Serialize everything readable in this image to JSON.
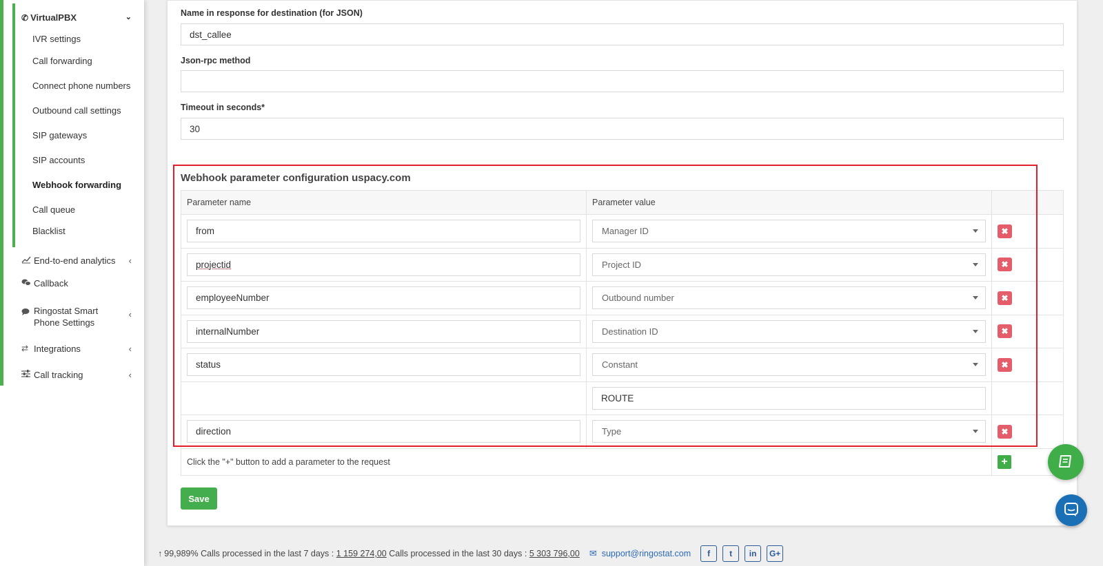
{
  "sidebar": {
    "section_title": "VirtualPBX",
    "sub_items": [
      {
        "label": "IVR settings"
      },
      {
        "label": "Call forwarding"
      },
      {
        "label": "Connect phone numbers"
      },
      {
        "label": "Outbound call settings"
      },
      {
        "label": "SIP gateways"
      },
      {
        "label": "SIP accounts"
      },
      {
        "label": "Webhook forwarding",
        "active": true
      },
      {
        "label": "Call queue"
      },
      {
        "label": "Blacklist"
      }
    ],
    "main_items": [
      {
        "label": "End-to-end analytics",
        "icon": "chart-line-icon"
      },
      {
        "label": "Callback",
        "icon": "chat-icon"
      },
      {
        "label": "Ringostat Smart Phone Settings",
        "icon": "comments-icon"
      },
      {
        "label": "Integrations",
        "icon": "exchange-icon"
      },
      {
        "label": "Call tracking",
        "icon": "sliders-icon"
      }
    ]
  },
  "form": {
    "name_response_label": "Name in response for destination (for JSON)",
    "name_response_value": "dst_callee",
    "jsonrpc_label": "Json-rpc method",
    "jsonrpc_value": "",
    "timeout_label": "Timeout in seconds*",
    "timeout_value": "30"
  },
  "webhook_config": {
    "title": "Webhook parameter configuration uspacy.com",
    "col_param_name": "Parameter name",
    "col_param_value": "Parameter value",
    "rows": [
      {
        "name": "from",
        "value": "Manager ID"
      },
      {
        "name": "projectid",
        "value": "Project ID"
      },
      {
        "name": "employeeNumber",
        "value": "Outbound number"
      },
      {
        "name": "internalNumber",
        "value": "Destination ID"
      },
      {
        "name": "status",
        "value": "Constant"
      },
      {
        "constant_value": "ROUTE"
      },
      {
        "name": "direction",
        "value": "Type"
      }
    ],
    "hint": "Click the \"+\" button to add a parameter to the request"
  },
  "save_label": "Save",
  "footer": {
    "uptime": "99,989%",
    "calls_7_label": "Calls processed in the last 7 days :",
    "calls_7_value": "1 159 274,00",
    "calls_30_label": "Calls processed in the last 30 days :",
    "calls_30_value": "5 303 796,00",
    "email": "support@ringostat.com",
    "social": [
      "f",
      "t",
      "in",
      "G+"
    ]
  },
  "colors": {
    "accent_green": "#4caf50",
    "delete_red": "#e35d6a",
    "highlight_red": "#e3202a",
    "chat_blue": "#1a6fb5"
  }
}
